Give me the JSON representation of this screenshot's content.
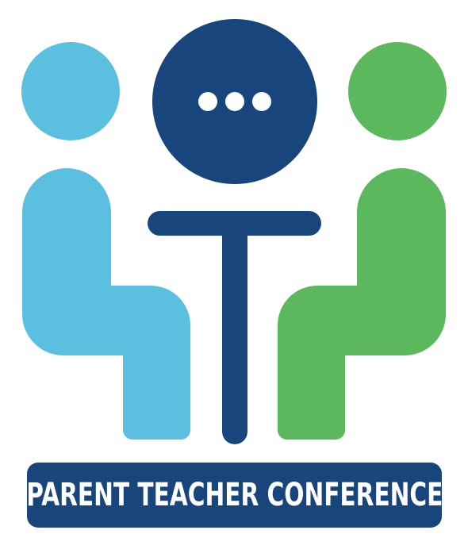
{
  "logo": {
    "title": "PARENT TEACHER CONFERENCE",
    "icons": {
      "parent": "seated-person-icon",
      "teacher": "seated-person-icon",
      "speech": "speech-bubble-icon",
      "table": "table-icon"
    },
    "colors": {
      "parent": "#5bc0df",
      "teacher": "#5cb85c",
      "navy": "#17457c",
      "text": "#ffffff",
      "background": "#ffffff"
    }
  }
}
